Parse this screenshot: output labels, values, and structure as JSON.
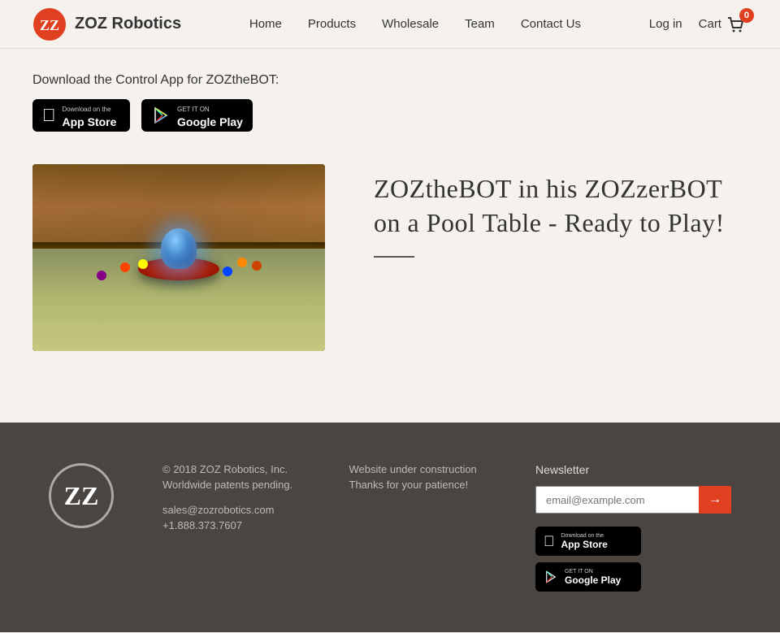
{
  "header": {
    "logo_text": "ZOZ Robotics",
    "nav_items": [
      {
        "label": "Home",
        "href": "#"
      },
      {
        "label": "Products",
        "href": "#"
      },
      {
        "label": "Wholesale",
        "href": "#"
      },
      {
        "label": "Team",
        "href": "#"
      },
      {
        "label": "Contact Us",
        "href": "#"
      }
    ],
    "login_label": "Log in",
    "cart_label": "Cart",
    "cart_count": "0"
  },
  "main": {
    "download_title": "Download the Control App for ZOZtheBOT:",
    "app_store": {
      "line1": "Download on the",
      "line2": "App Store"
    },
    "google_play": {
      "line1": "GET IT ON",
      "line2": "Google Play"
    },
    "product_title": "ZOZtheBOT in his ZOZzerBOT on a Pool Table - Ready to Play!"
  },
  "footer": {
    "copyright": "© 2018 ZOZ Robotics, Inc.",
    "patents": "Worldwide patents pending.",
    "email": "sales@zozrobotics.com",
    "phone": "+1.888.373.7607",
    "status_line1": "Website under construction",
    "status_line2": "Thanks for your patience!",
    "newsletter_title": "Newsletter",
    "newsletter_placeholder": "email@example.com",
    "app_store": {
      "line1": "Download on the",
      "line2": "App Store"
    },
    "google_play": {
      "line1": "GET IT ON",
      "line2": "Google Play"
    }
  }
}
